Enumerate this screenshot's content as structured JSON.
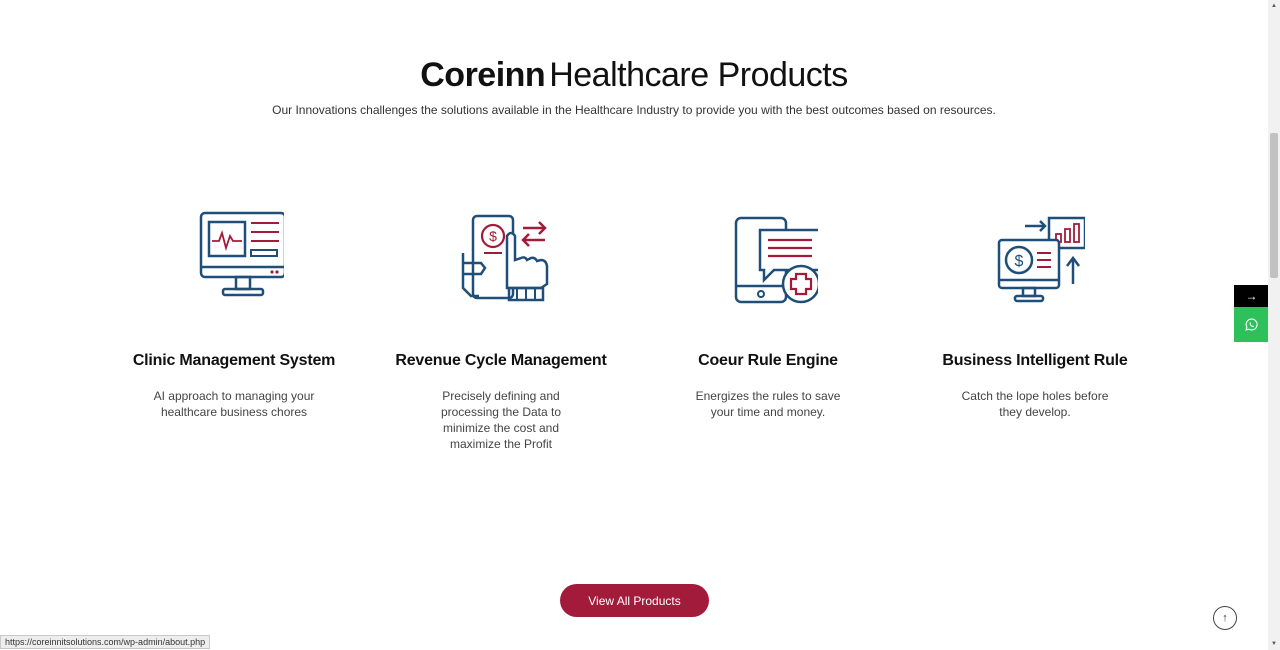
{
  "section": {
    "brand": "Coreinn",
    "title_rest": "Healthcare Products",
    "subtitle": "Our Innovations challenges the solutions available in the Healthcare Industry to provide you with the best outcomes based on resources."
  },
  "products": [
    {
      "title": "Clinic Management System",
      "description": "AI approach to managing your healthcare business chores",
      "icon": "monitor-icon"
    },
    {
      "title": "Revenue Cycle Management",
      "description": "Precisely defining and processing the Data to minimize the cost and maximize the Profit",
      "icon": "hand-payment-icon"
    },
    {
      "title": "Coeur Rule Engine",
      "description": "Energizes the rules to save your time and money.",
      "icon": "tablet-medical-chat-icon"
    },
    {
      "title": "Business Intelligent Rule",
      "description": "Catch the lope holes before they develop.",
      "icon": "analytics-monitor-icon"
    }
  ],
  "cta": {
    "label": "View All Products"
  },
  "side": {
    "arrow": "→",
    "whatsapp_icon": "whatsapp-icon"
  },
  "scroll_top": {
    "label": "↑"
  },
  "status_bar": {
    "url": "https://coreinnitsolutions.com/wp-admin/about.php"
  },
  "colors": {
    "accent": "#a31b3a",
    "icon_blue": "#1f4e79",
    "whatsapp": "#2ec15b"
  }
}
